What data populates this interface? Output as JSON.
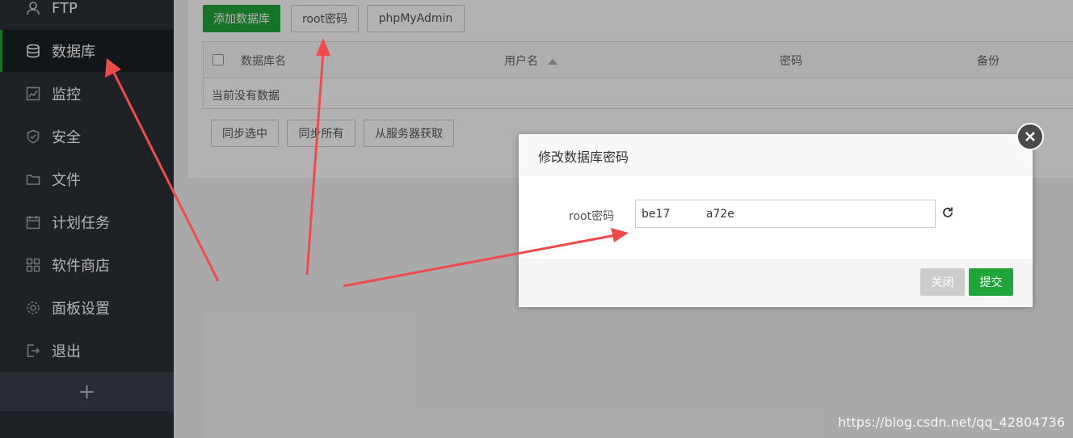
{
  "sidebar": {
    "items": [
      {
        "label": "FTP",
        "icon": "user-icon"
      },
      {
        "label": "数据库",
        "icon": "database-icon",
        "active": true
      },
      {
        "label": "监控",
        "icon": "monitor-icon"
      },
      {
        "label": "安全",
        "icon": "shield-icon"
      },
      {
        "label": "文件",
        "icon": "folder-icon"
      },
      {
        "label": "计划任务",
        "icon": "calendar-icon"
      },
      {
        "label": "软件商店",
        "icon": "grid-icon"
      },
      {
        "label": "面板设置",
        "icon": "gear-icon"
      },
      {
        "label": "退出",
        "icon": "logout-icon"
      }
    ],
    "add_label": "+"
  },
  "toolbar": {
    "add_db": "添加数据库",
    "root_password": "root密码",
    "phpmyadmin": "phpMyAdmin"
  },
  "table": {
    "headers": [
      "数据库名",
      "用户名",
      "密码",
      "备份"
    ],
    "empty_text": "当前没有数据"
  },
  "actions": {
    "sync_selected": "同步选中",
    "sync_all": "同步所有",
    "fetch_from_server": "从服务器获取"
  },
  "modal": {
    "title": "修改数据库密码",
    "label": "root密码",
    "value": "be17          a72e",
    "close_label": "关闭",
    "submit_label": "提交"
  },
  "watermark": "https://blog.csdn.net/qq_42804736",
  "colors": {
    "accent": "#20a53a",
    "sidebar": "#2c3138",
    "arrow": "#f04a4a"
  }
}
